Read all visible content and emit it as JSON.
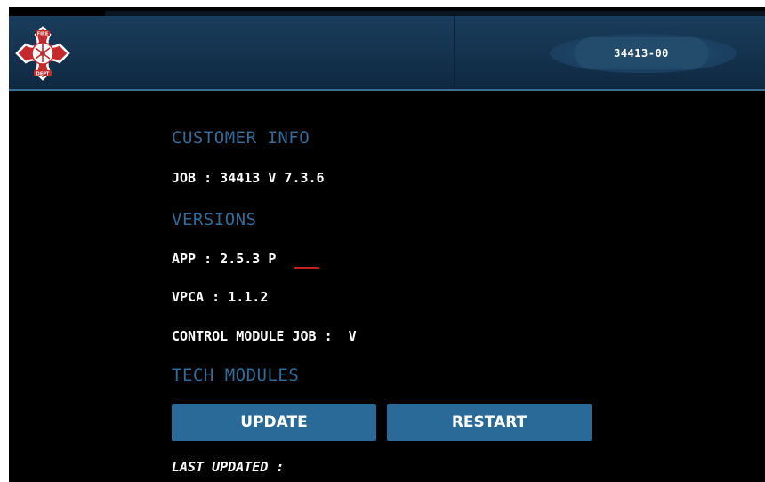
{
  "header": {
    "logo_icon": "fire-dept-maltese-cross-icon",
    "job_number": "34413-00"
  },
  "customer_info": {
    "heading": "CUSTOMER INFO",
    "job_line": "JOB : 34413 V 7.3.6"
  },
  "versions": {
    "heading": "VERSIONS",
    "app_line": "APP : 2.5.3 P",
    "vpca_line": "VPCA : 1.1.2",
    "control_module_line": "CONTROL MODULE JOB :  V"
  },
  "tech_modules": {
    "heading": "TECH MODULES",
    "update_label": "UPDATE",
    "restart_label": "RESTART",
    "last_updated_label": "LAST UPDATED :"
  },
  "colors": {
    "header": "#14324d",
    "section_heading": "#2e6c99",
    "button": "#2a6a98",
    "annotation_underline": "#c42020"
  }
}
